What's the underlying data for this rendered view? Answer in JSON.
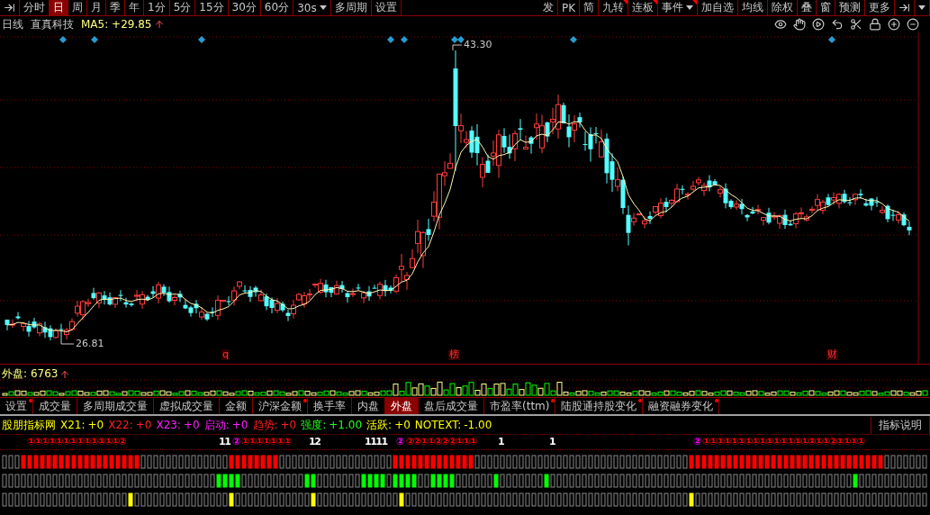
{
  "toolbar": {
    "left": [
      {
        "label": "分时",
        "selected": false
      },
      {
        "label": "日",
        "selected": true
      },
      {
        "label": "周",
        "selected": false
      },
      {
        "label": "月",
        "selected": false
      },
      {
        "label": "季",
        "selected": false
      },
      {
        "label": "年",
        "selected": false
      },
      {
        "label": "1分",
        "selected": false
      },
      {
        "label": "5分",
        "selected": false
      },
      {
        "label": "15分",
        "selected": false
      },
      {
        "label": "30分",
        "selected": false
      },
      {
        "label": "60分",
        "selected": false
      },
      {
        "label": "30s",
        "selected": false,
        "kind": "dropdown"
      },
      {
        "label": "多周期",
        "selected": false
      },
      {
        "label": "设置",
        "selected": false
      }
    ],
    "right": [
      {
        "label": "发",
        "marked": false
      },
      {
        "label": "PK",
        "marked": false
      },
      {
        "label": "简",
        "marked": false
      },
      {
        "label": "九转",
        "marked": true
      },
      {
        "label": "连板",
        "marked": true
      },
      {
        "label": "事件",
        "marked": true,
        "kind": "dropdown"
      },
      {
        "label": "加自选",
        "marked": false
      },
      {
        "label": "均线",
        "marked": false
      },
      {
        "label": "除权",
        "marked": false
      },
      {
        "label": "叠",
        "marked": false
      },
      {
        "label": "窗",
        "marked": false
      },
      {
        "label": "预测",
        "marked": false
      },
      {
        "label": "更多",
        "marked": false
      }
    ]
  },
  "header": {
    "period": "日线",
    "stock": "直真科技",
    "ma_label": "MA5:",
    "ma_value": "+29.85"
  },
  "chart": {
    "high_label": "43.30",
    "low_label": "26.81",
    "events": [
      {
        "text": "q"
      },
      {
        "text": "榜"
      },
      {
        "text": "财"
      }
    ]
  },
  "volume": {
    "label": "外盘:",
    "value": "6763"
  },
  "tabs": [
    {
      "label": "设置",
      "selected": false,
      "dot": true
    },
    {
      "label": "成交量",
      "selected": false,
      "dot": false
    },
    {
      "label": "多周期成交量",
      "selected": false,
      "dot": false
    },
    {
      "label": "虚拟成交量",
      "selected": false,
      "dot": false
    },
    {
      "label": "金额",
      "selected": false,
      "dot": false
    },
    {
      "label": "沪深金额",
      "selected": false,
      "dot": true
    },
    {
      "label": "换手率",
      "selected": false,
      "dot": false
    },
    {
      "label": "内盘",
      "selected": false,
      "dot": false
    },
    {
      "label": "外盘",
      "selected": true,
      "dot": false
    },
    {
      "label": "盘后成交量",
      "selected": false,
      "dot": false
    },
    {
      "label": "市盈率(ttm)",
      "selected": false,
      "dot": true
    },
    {
      "label": "陆股通持股变化",
      "selected": false,
      "dot": true
    },
    {
      "label": "融资融券变化",
      "selected": false,
      "dot": true
    }
  ],
  "indicator": {
    "name": "股朋指标网",
    "values": [
      {
        "label": "X21:",
        "value": "+0",
        "color": "#ffff00"
      },
      {
        "label": "X22:",
        "value": "+0",
        "color": "#ff2020"
      },
      {
        "label": "X23:",
        "value": "+0",
        "color": "#ff20ff"
      },
      {
        "label": "启动:",
        "value": "+0",
        "color": "#ff20ff"
      },
      {
        "label": "趋势:",
        "value": "+0",
        "color": "#ff2020"
      },
      {
        "label": "强度:",
        "value": "+1.00",
        "color": "#20ff20"
      },
      {
        "label": "活跃:",
        "value": "+0",
        "color": "#ffff00"
      },
      {
        "label": "NOTEXT:",
        "value": "-1.00",
        "color": "#ffff00"
      }
    ],
    "help_button": "指标说明"
  },
  "signals": [
    {
      "text": "①①①①①①①①①①①①①②",
      "color": "#ff0000"
    },
    {
      "text": "11",
      "color": "#ffffff"
    },
    {
      "text": "②",
      "color": "#ff00ff"
    },
    {
      "text": "①①①①①①①",
      "color": "#ff0000"
    },
    {
      "text": "12",
      "color": "#ffffff"
    },
    {
      "text": "1111",
      "color": "#ffffff"
    },
    {
      "text": "②",
      "color": "#ff00ff"
    },
    {
      "text": "②②①①②②②①①①",
      "color": "#ff0000"
    },
    {
      "text": "1",
      "color": "#ffffff"
    },
    {
      "text": "1",
      "color": "#ffffff"
    },
    {
      "text": "②",
      "color": "#ff00ff"
    },
    {
      "text": "①①①①①①①①①①①①①①①①①①②①①①①",
      "color": "#ff0000"
    }
  ]
}
